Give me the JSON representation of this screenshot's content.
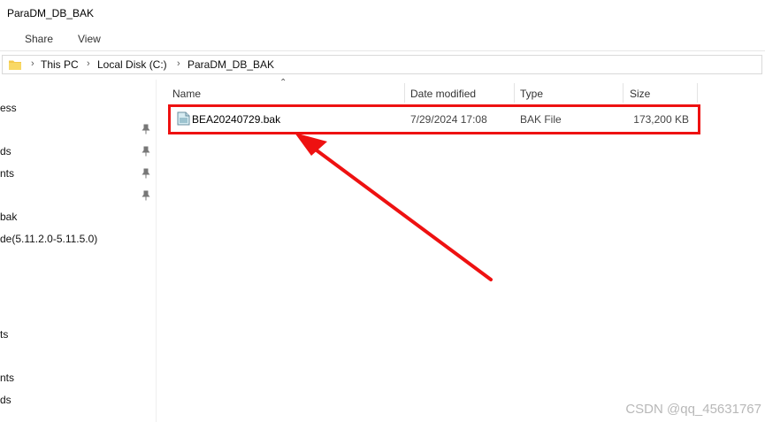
{
  "window": {
    "title": "ParaDM_DB_BAK"
  },
  "ribbon": {
    "tabs": [
      "Share",
      "View"
    ]
  },
  "address": {
    "crumbs": [
      "This PC",
      "Local Disk (C:)",
      "ParaDM_DB_BAK"
    ]
  },
  "nav": {
    "items": [
      "ess",
      "ds",
      "nts",
      "",
      "bak",
      "de(5.11.2.0-5.11.5.0)",
      "ts",
      "nts",
      "ds"
    ]
  },
  "columns": {
    "name": "Name",
    "date": "Date modified",
    "type": "Type",
    "size": "Size"
  },
  "file": {
    "name": "BEA20240729.bak",
    "date": "7/29/2024 17:08",
    "type": "BAK File",
    "size": "173,200 KB"
  },
  "watermark": "CSDN @qq_45631767",
  "colors": {
    "highlight": "#ee1111"
  }
}
